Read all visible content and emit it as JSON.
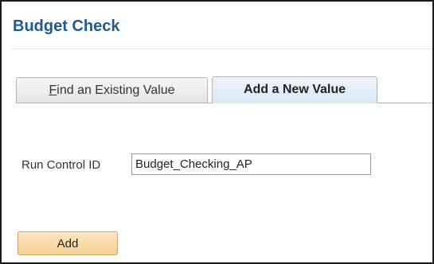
{
  "page": {
    "title": "Budget Check"
  },
  "tabs": [
    {
      "accel": "F",
      "rest": "ind an Existing Value",
      "selected": false
    },
    {
      "label": "Add a New Value",
      "selected": true
    }
  ],
  "form": {
    "run_control_label": "Run Control ID",
    "run_control_value": "Budget_Checking_AP"
  },
  "actions": {
    "add_label": "Add"
  },
  "colors": {
    "title": "#1d5a96",
    "button_fill": "#f6cf92",
    "active_tab": "#d9e7f6"
  }
}
